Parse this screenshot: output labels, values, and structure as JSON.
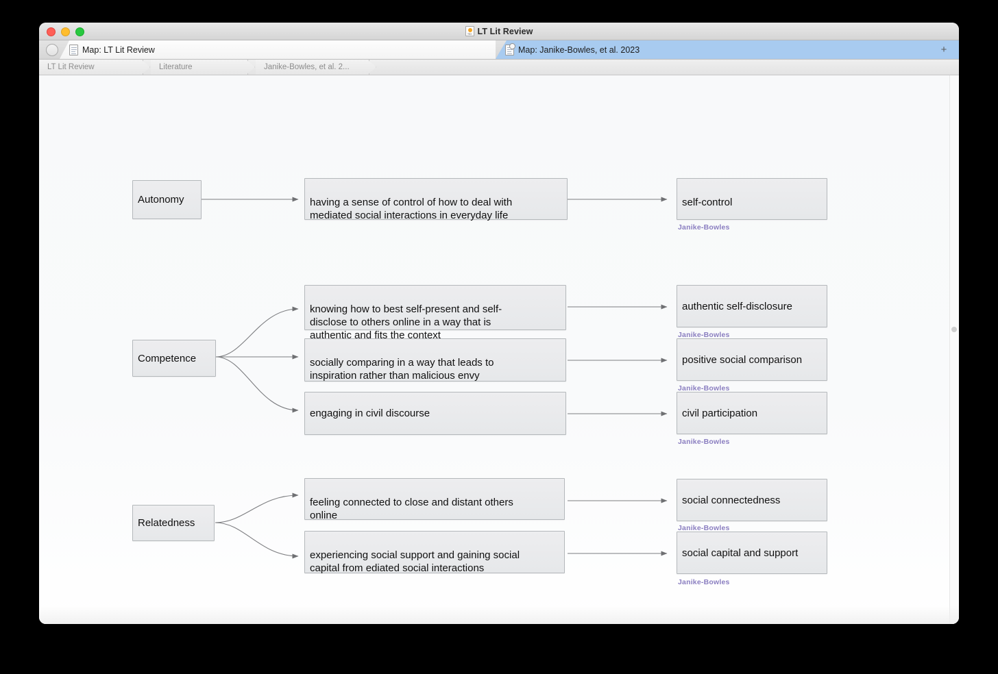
{
  "window": {
    "title": "LT Lit Review",
    "title_icon": "tex-document-icon",
    "traffic_lights": [
      "close",
      "minimize",
      "zoom"
    ]
  },
  "tabs": {
    "new_tab_label": "+",
    "items": [
      {
        "label": "Map: LT Lit Review",
        "active": false,
        "icon": "document-icon"
      },
      {
        "label": "Map: Janike-Bowles, et al. 2023",
        "active": true,
        "icon": "document-icon-modified"
      }
    ]
  },
  "breadcrumb": {
    "items": [
      {
        "label": "LT Lit Review"
      },
      {
        "label": "Literature"
      },
      {
        "label": "Janike-Bowles, et al. 2..."
      }
    ]
  },
  "colors": {
    "accent_tab": "#a8cbf0",
    "node_fill": "#e9ebed",
    "node_border": "#b4b8bb",
    "citation": "#8a7ec0",
    "edge": "#7c7c7c",
    "canvas": "#f8f9fa"
  },
  "map": {
    "groups": [
      {
        "root": "Autonomy",
        "branches": [
          {
            "description": "having a sense of control of how to deal with\nmediated social interactions in everyday life",
            "outcome": "self-control",
            "citation": "Janike-Bowles"
          }
        ]
      },
      {
        "root": "Competence",
        "branches": [
          {
            "description": "knowing how to best self-present and self-\ndisclose to others online in a way that is\nauthentic and fits the context",
            "outcome": "authentic self-disclosure",
            "citation": "Janike-Bowles"
          },
          {
            "description": "socially comparing in a way that leads to\ninspiration rather than malicious envy",
            "outcome": "positive social comparison",
            "citation": "Janike-Bowles"
          },
          {
            "description": "engaging in civil discourse",
            "outcome": "civil participation",
            "citation": "Janike-Bowles"
          }
        ]
      },
      {
        "root": "Relatedness",
        "branches": [
          {
            "description": "feeling connected to close and distant others\nonline",
            "outcome": "social connectedness",
            "citation": "Janike-Bowles"
          },
          {
            "description": "experiencing social support and gaining social\ncapital from ediated social interactions",
            "outcome": "social capital and support",
            "citation": "Janike-Bowles"
          }
        ]
      }
    ]
  }
}
